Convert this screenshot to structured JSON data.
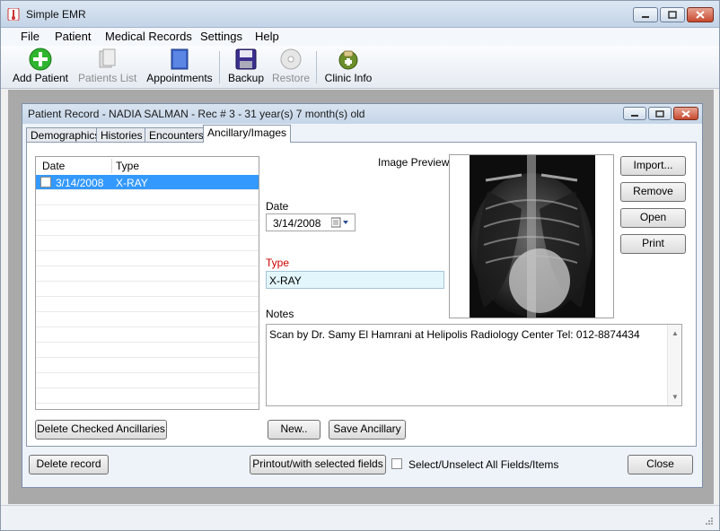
{
  "app": {
    "title": "Simple EMR",
    "accent": "#3399ff"
  },
  "menu": [
    "File",
    "Patient",
    "Medical Records",
    "Settings",
    "Help"
  ],
  "toolbar": {
    "add_patient": "Add Patient",
    "patients_list": "Patients List",
    "appointments": "Appointments",
    "backup": "Backup",
    "restore": "Restore",
    "clinic_info": "Clinic Info"
  },
  "child": {
    "title": "Patient Record - NADIA SALMAN - Rec # 3 - 31 year(s) 7 month(s) old",
    "tabs": [
      "Demographics",
      "Histories",
      "Encounters",
      "Ancillary/Images"
    ],
    "active_tab": "Ancillary/Images"
  },
  "list": {
    "col_date": "Date",
    "col_type": "Type",
    "rows": [
      {
        "date": "3/14/2008",
        "type": "X-RAY",
        "checked": false,
        "selected": true
      }
    ]
  },
  "form": {
    "date_label": "Date",
    "date_value": "3/14/2008",
    "type_label": "Type",
    "type_value": "X-RAY",
    "type_label_color": "#cc0000",
    "notes_label": "Notes",
    "notes_value": "Scan by Dr. Samy El Hamrani at Helipolis Radiology Center Tel: 012-8874434",
    "image_preview_label": "Image Preview"
  },
  "buttons": {
    "import": "Import...",
    "remove": "Remove",
    "open": "Open",
    "print": "Print",
    "delete_checked": "Delete Checked Ancillaries",
    "new": "New..",
    "save_ancillary": "Save Ancillary",
    "delete_record": "Delete record",
    "printout": "Printout/with selected fields",
    "select_all": "Select/Unselect All Fields/Items",
    "close": "Close"
  }
}
